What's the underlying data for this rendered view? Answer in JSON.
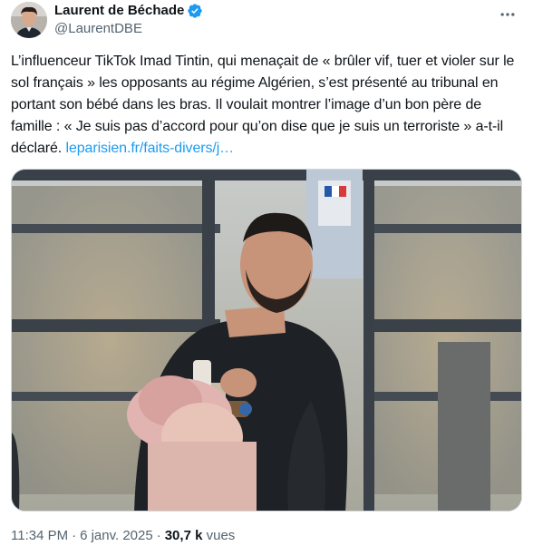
{
  "author": {
    "name": "Laurent de Béchade",
    "handle": "@LaurentDBE",
    "verified": true,
    "avatar_icon": "avatar-photo"
  },
  "tweet": {
    "text": "L’influenceur TikTok Imad Tintin, qui menaçait de « brûler vif, tuer et violer sur le sol français » les opposants au régime Algérien, s’est présenté au tribunal en portant son bébé dans les bras. Il voulait montrer l’image d’un bon père de famille : « Je suis pas d’accord pour qu’on dise que je suis un terroriste » a-t-il déclaré.",
    "link_text": "leparisien.fr/faits-divers/j…"
  },
  "media": {
    "description_icon": "photo"
  },
  "meta": {
    "time": "11:34 PM",
    "separator": "·",
    "date": "6 janv. 2025",
    "views_count": "30,7 k",
    "views_label": "vues"
  },
  "colors": {
    "accent": "#1d9bf0",
    "text": "#0f1419",
    "secondary": "#536471"
  }
}
